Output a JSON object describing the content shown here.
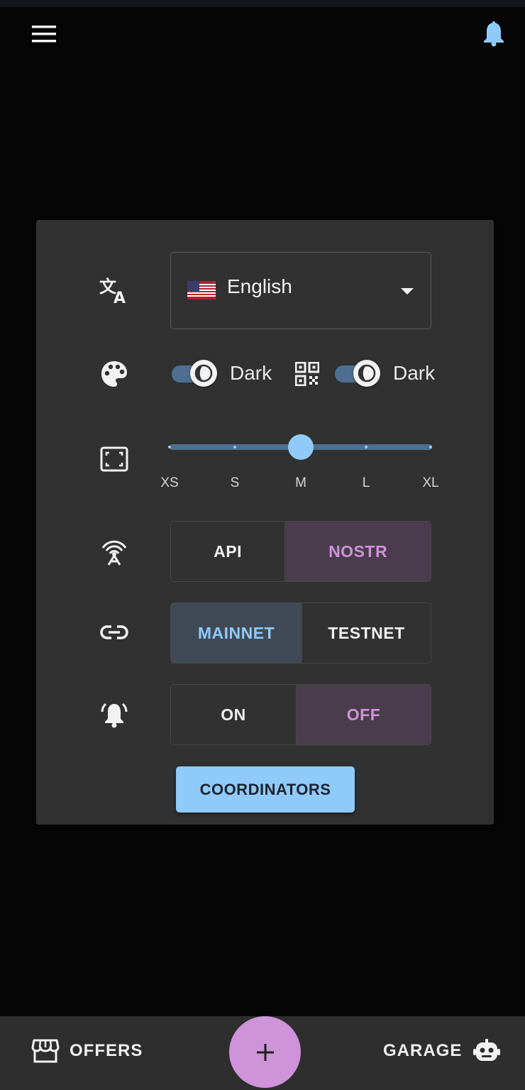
{
  "header": {
    "menu_icon": "hamburger-menu-icon",
    "notification_icon": "bell-icon",
    "accent_color": "#90caf9"
  },
  "settings": {
    "language": {
      "icon": "translate-icon",
      "flag_icon": "us-flag-icon",
      "selected": "English"
    },
    "theme": {
      "icon": "palette-icon",
      "mode_label": "Dark",
      "qr_icon": "qr-code-icon",
      "qr_label": "Dark"
    },
    "size": {
      "icon": "fit-screen-icon",
      "ticks": [
        "XS",
        "S",
        "M",
        "L",
        "XL"
      ],
      "selected": "M"
    },
    "connection": {
      "icon": "broadcast-icon",
      "options": [
        "API",
        "NOSTR"
      ],
      "selected": "NOSTR"
    },
    "network": {
      "icon": "link-icon",
      "options": [
        "MAINNET",
        "TESTNET"
      ],
      "selected": "MAINNET"
    },
    "notifications": {
      "icon": "ringing-bell-icon",
      "options": [
        "ON",
        "OFF"
      ],
      "selected": "OFF"
    },
    "coordinators_button": "COORDINATORS"
  },
  "bottom_nav": {
    "offers": {
      "label": "OFFERS",
      "icon": "storefront-icon"
    },
    "create": {
      "label": "+",
      "icon": "plus-icon",
      "color": "#ce93d8"
    },
    "garage": {
      "label": "GARAGE",
      "icon": "robot-icon"
    }
  }
}
